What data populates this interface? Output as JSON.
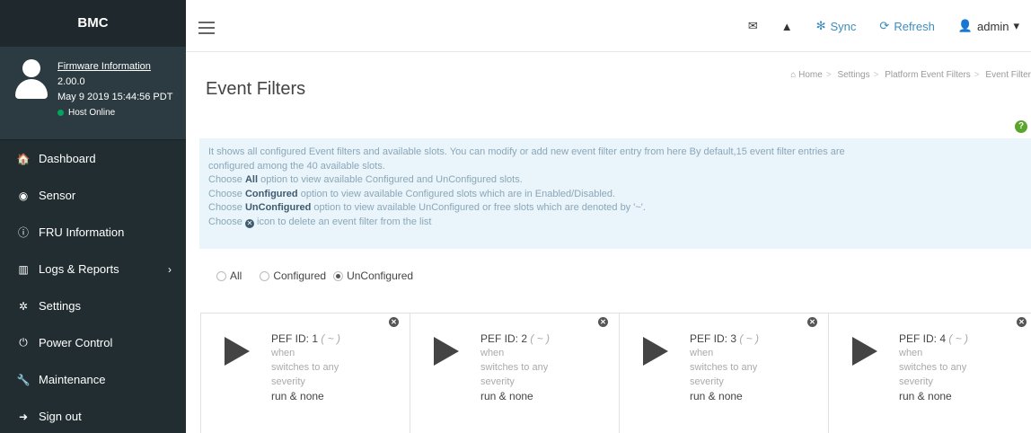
{
  "sidebar": {
    "brand": "BMC",
    "user": {
      "firmware_link": "Firmware Information",
      "version": "2.00.0",
      "date": "May 9 2019 15:44:56 PDT",
      "host_status": "Host Online"
    },
    "items": [
      {
        "label": "Dashboard",
        "icon": "home-icon",
        "glyph": "🏠"
      },
      {
        "label": "Sensor",
        "icon": "dashboard-icon",
        "glyph": "◉"
      },
      {
        "label": "FRU Information",
        "icon": "info-icon",
        "glyph": "ⓘ"
      },
      {
        "label": "Logs & Reports",
        "icon": "bar-chart-icon",
        "glyph": "▥"
      },
      {
        "label": "Settings",
        "icon": "gear-icon",
        "glyph": "✲"
      },
      {
        "label": "Power Control",
        "icon": "power-icon",
        "glyph": "⏻"
      },
      {
        "label": "Maintenance",
        "icon": "wrench-icon",
        "glyph": "🔧"
      },
      {
        "label": "Sign out",
        "icon": "sign-out-icon",
        "glyph": "➜"
      }
    ]
  },
  "navbar": {
    "sync": "Sync",
    "refresh": "Refresh",
    "user": "admin"
  },
  "page": {
    "title": "Event Filters",
    "breadcrumb": [
      "Home",
      "Settings",
      "Platform Event Filters",
      "Event Filter"
    ]
  },
  "callout": {
    "line1a": "It shows all configured Event filters and available slots. You can modify or add new event filter entry from here By default,15 event filter entries are",
    "line1b": "configured among the 40 available slots.",
    "l2_pre": "Choose ",
    "l2_b": "All",
    "l2_post": " option to view available Configured and UnConfigured slots.",
    "l3_pre": "Choose ",
    "l3_b": "Configured",
    "l3_post": " option to view available Configured slots which are in Enabled/Disabled.",
    "l4_pre": "Choose ",
    "l4_b": "UnConfigured",
    "l4_post": " option to view available UnConfigured or free slots which are denoted by '~'.",
    "l5_pre": "Choose ",
    "l5_post": " icon to delete an event filter from the list"
  },
  "filters": {
    "options": [
      "All",
      "Configured",
      "UnConfigured"
    ],
    "selected": "UnConfigured"
  },
  "cards": [
    {
      "pid": "PEF ID: 1",
      "tilde": "( ~ )",
      "when": "when",
      "switches": "switches to any",
      "severity": "severity",
      "run": "run & none"
    },
    {
      "pid": "PEF ID: 2",
      "tilde": "( ~ )",
      "when": "when",
      "switches": "switches to any",
      "severity": "severity",
      "run": "run & none"
    },
    {
      "pid": "PEF ID: 3",
      "tilde": "( ~ )",
      "when": "when",
      "switches": "switches to any",
      "severity": "severity",
      "run": "run & none"
    },
    {
      "pid": "PEF ID: 4",
      "tilde": "( ~ )",
      "when": "when",
      "switches": "switches to any",
      "severity": "severity",
      "run": "run & none"
    }
  ]
}
